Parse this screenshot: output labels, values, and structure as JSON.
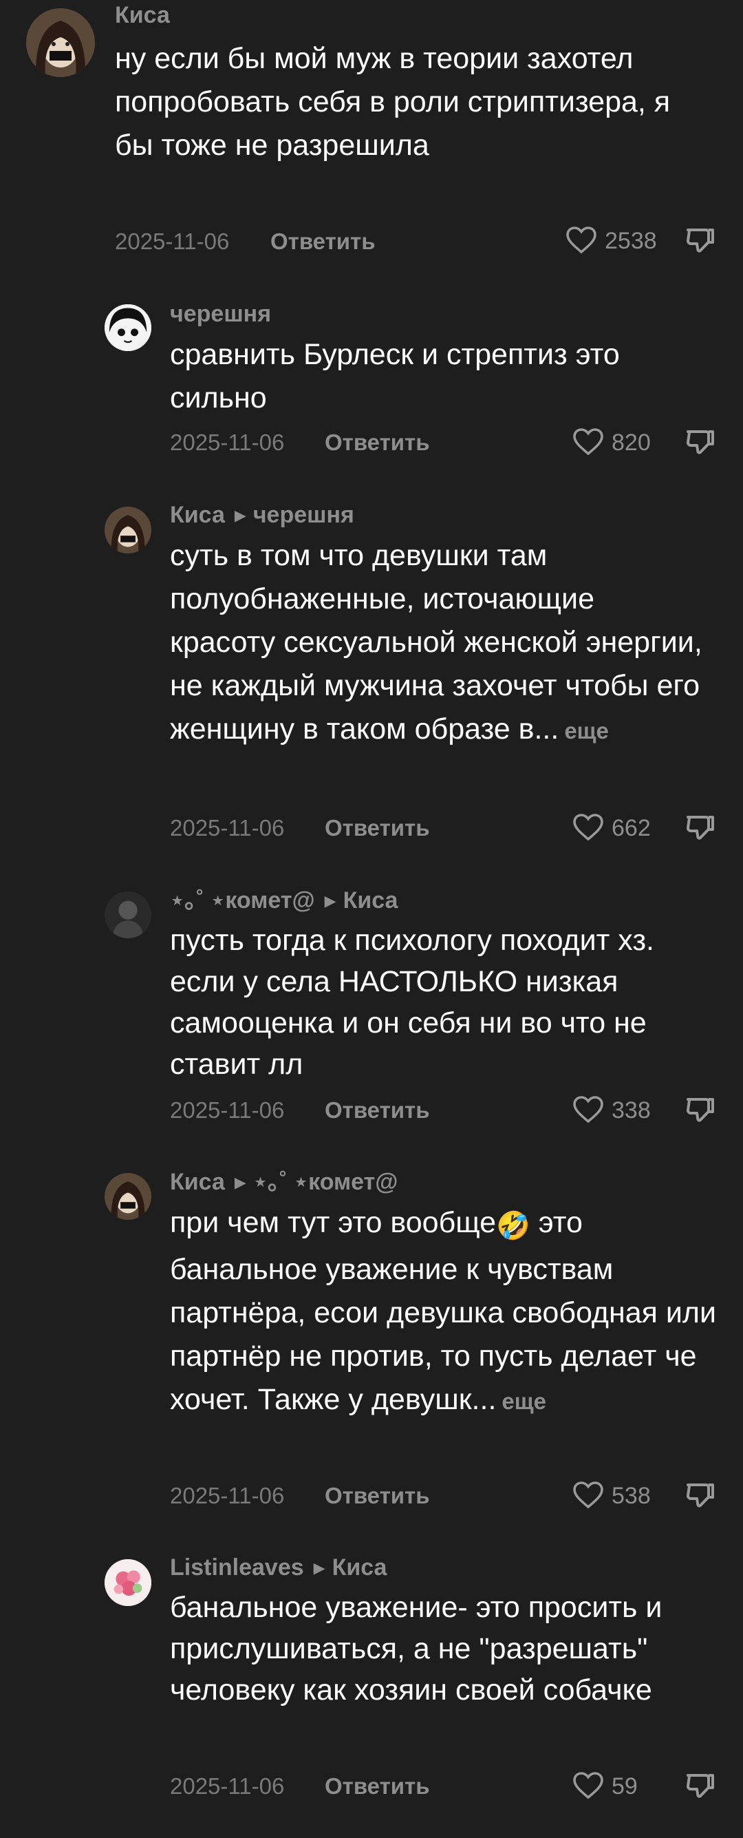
{
  "comments": [
    {
      "author": "Киса",
      "reply_to": "",
      "text": "ну если бы мой муж в теории захотел попробовать себя в роли стриптизера, я бы тоже не разрешила",
      "date": "2025-11-06",
      "reply_label": "Ответить",
      "likes": "2538",
      "more": ""
    },
    {
      "author": "черешня",
      "reply_to": "",
      "text": "сравнить Бурлеск и стрептиз это сильно",
      "date": "2025-11-06",
      "reply_label": "Ответить",
      "likes": "820",
      "more": ""
    },
    {
      "author": "Киса",
      "reply_to": "черешня",
      "text": "суть в том что девушки там полуобнаженные, источающие красоту сексуальной женской энергии, не каждый мужчина захочет чтобы его женщину в таком образе в...",
      "date": "2025-11-06",
      "reply_label": "Ответить",
      "likes": "662",
      "more": "еще"
    },
    {
      "author": "⋆｡˚ ⋆комет@",
      "reply_to": "Киса",
      "text": "пусть тогда к психологу походит хз. если у села НАСТОЛЬКО низкая самооценка и он себя ни во что не ставит лл",
      "date": "2025-11-06",
      "reply_label": "Ответить",
      "likes": "338",
      "more": ""
    },
    {
      "author": "Киса",
      "reply_to": "⋆｡˚ ⋆комет@",
      "text_before": "при чем тут это вообще",
      "emoji": "🤣",
      "text": "это банальное уважение к чувствам партнёра, есои девушка свободная или партнёр не против, то пусть делает че хочет. Также у девушк...",
      "date": "2025-11-06",
      "reply_label": "Ответить",
      "likes": "538",
      "more": "еще"
    },
    {
      "author": "Listinleaves",
      "reply_to": "Киса",
      "text": "банальное уважение- это просить и прислушиваться, а не \"разрешать\" человеку как хозяин своей собачке",
      "date": "2025-11-06",
      "reply_label": "Ответить",
      "likes": "59",
      "more": ""
    }
  ],
  "icons": {
    "like": "heart-outline-icon",
    "dislike": "thumbs-down-outline-icon",
    "reply_arrow": "triangle-right-icon"
  },
  "colors": {
    "background": "#1e1e1e",
    "text": "#ffffff",
    "secondary": "#8e8e8e"
  }
}
